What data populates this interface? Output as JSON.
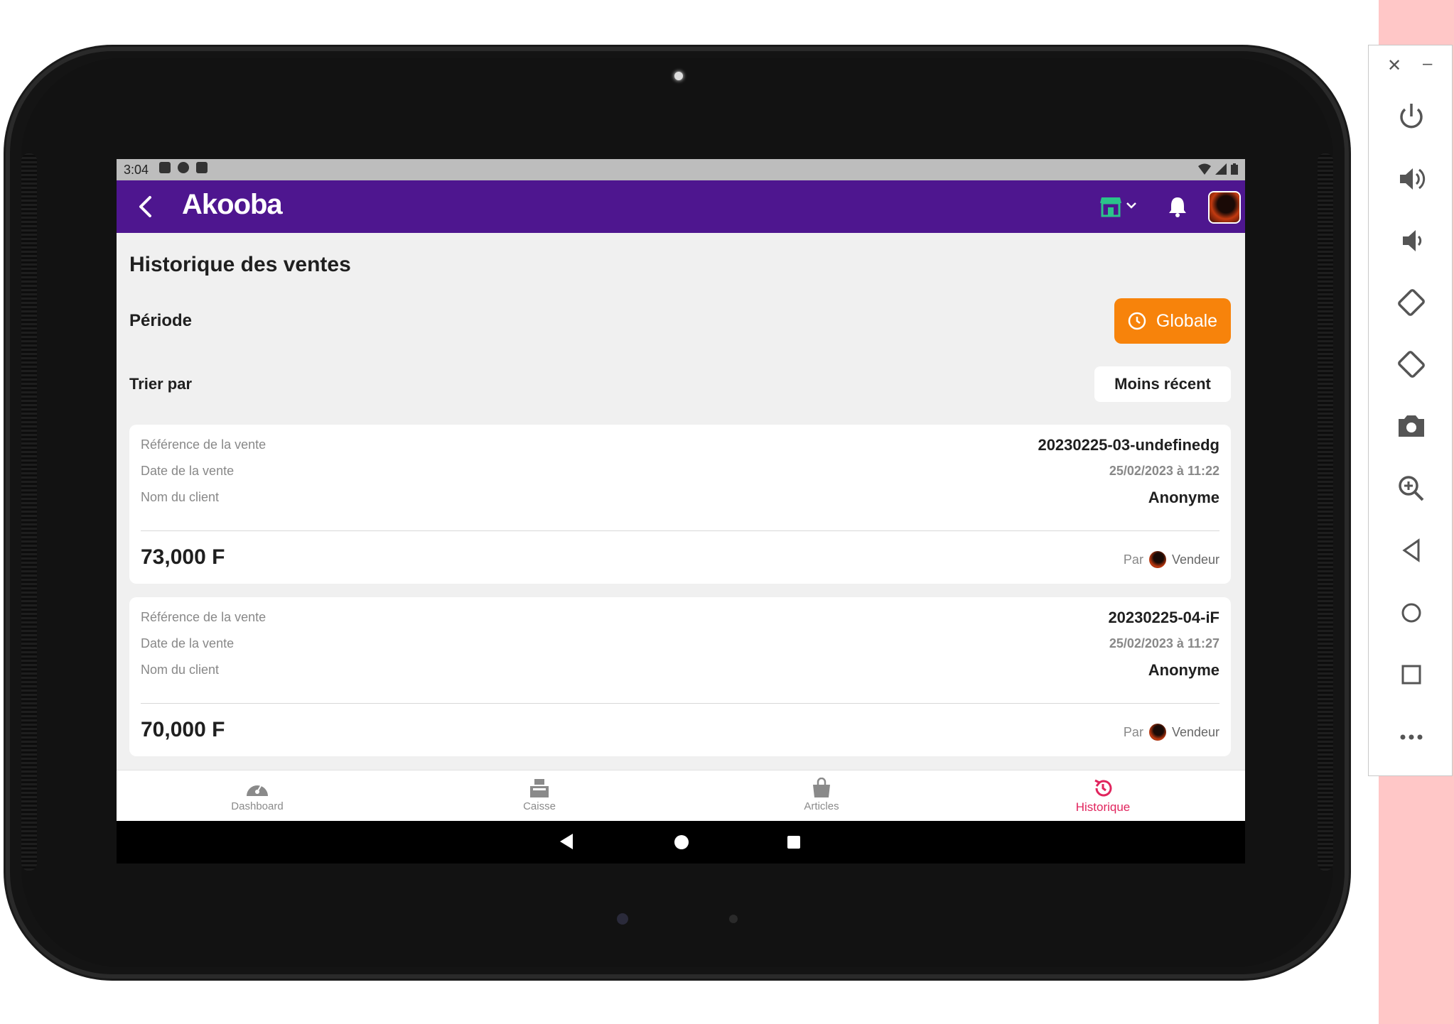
{
  "status_bar": {
    "time": "3:04"
  },
  "app": {
    "logo": "Akooba",
    "accent": "#4e168f"
  },
  "page": {
    "title": "Historique des ventes"
  },
  "filters": {
    "periode_label": "Période",
    "periode_value": "Globale",
    "trier_label": "Trier par",
    "trier_value": "Moins récent"
  },
  "labels": {
    "reference": "Référence de la vente",
    "date": "Date de la vente",
    "client": "Nom du client",
    "par": "Par"
  },
  "sales": [
    {
      "reference": "20230225-03-undefinedg",
      "date": "25/02/2023 à 11:22",
      "client": "Anonyme",
      "amount": "73,000 F",
      "seller": "Vendeur"
    },
    {
      "reference": "20230225-04-iF",
      "date": "25/02/2023 à 11:27",
      "client": "Anonyme",
      "amount": "70,000 F",
      "seller": "Vendeur"
    }
  ],
  "bottom_nav": [
    {
      "label": "Dashboard",
      "icon": "gauge-icon"
    },
    {
      "label": "Caisse",
      "icon": "cash-register-icon"
    },
    {
      "label": "Articles",
      "icon": "shopping-bag-icon"
    },
    {
      "label": "Historique",
      "icon": "history-icon",
      "active": true,
      "color": "#e1245d"
    }
  ],
  "emulator_toolbar": [
    "close-icon",
    "minimize-icon",
    "power-icon",
    "volume-up-icon",
    "volume-down-icon",
    "rotate-left-icon",
    "rotate-right-icon",
    "camera-icon",
    "zoom-icon",
    "back-icon",
    "home-icon",
    "overview-icon",
    "more-icon"
  ]
}
